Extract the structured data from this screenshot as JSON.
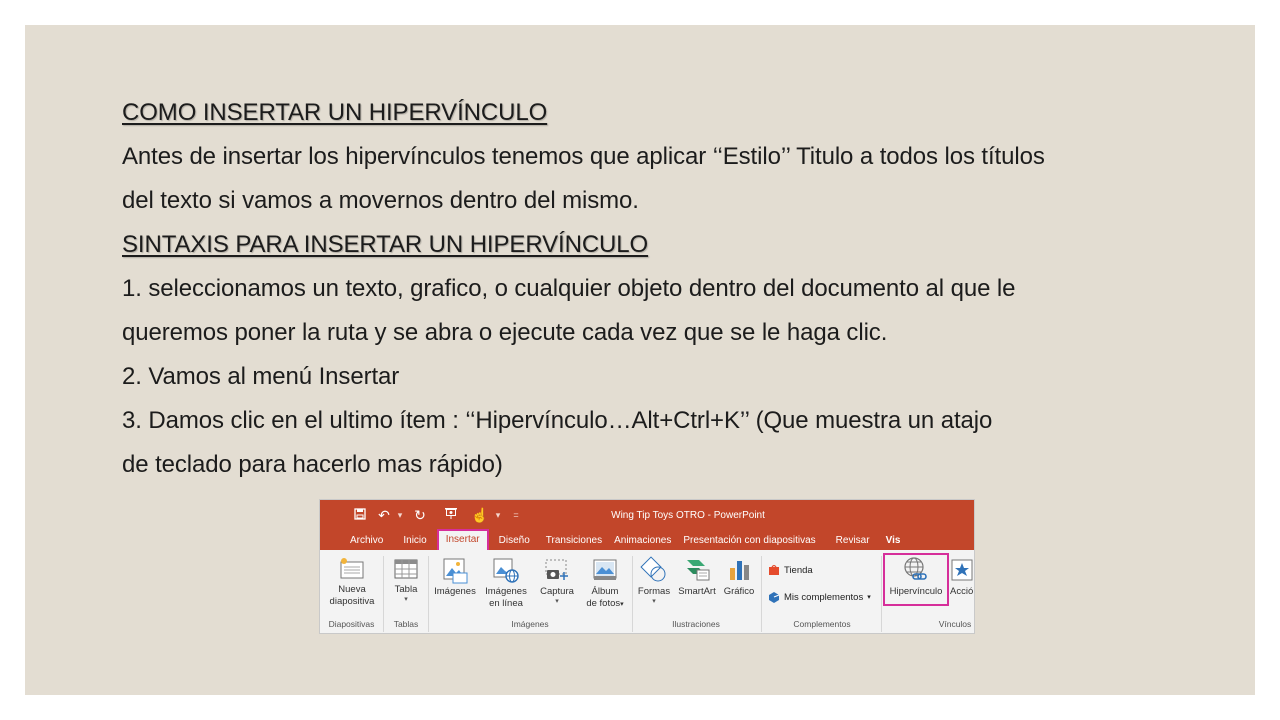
{
  "slide": {
    "heading1": "COMO INSERTAR UN HIPERVÍNCULO",
    "para1_line1": "Antes de insertar los hipervínculos tenemos que aplicar ‘‘Estilo’’ Titulo a todos los títulos",
    "para1_line2": "del texto si vamos a movernos dentro del mismo.",
    "heading2": "SINTAXIS PARA INSERTAR UN HIPERVÍNCULO",
    "step1_line1": "1. seleccionamos un texto, grafico, o cualquier objeto dentro del documento al que le",
    "step1_line2": "queremos poner la ruta y se abra o ejecute cada vez que se le haga clic.",
    "step2": "2. Vamos al menú Insertar",
    "step3_line1": "3. Damos clic en el ultimo ítem : ‘‘Hipervínculo…Alt+Ctrl+K’’ (Que muestra un atajo",
    "step3_line2": "de teclado para hacerlo mas rápido)"
  },
  "ribbon": {
    "window_title": "Wing Tip Toys OTRO - PowerPoint",
    "tabs": [
      "Archivo",
      "Inicio",
      "Insertar",
      "Diseño",
      "Transiciones",
      "Animaciones",
      "Presentación con diapositivas",
      "Revisar",
      "Vis"
    ],
    "active_tab": "Insertar",
    "buttons": {
      "nueva_line1": "Nueva",
      "nueva_line2": "diapositiva",
      "tabla": "Tabla",
      "imagenes": "Imágenes",
      "imagenes_linea_line1": "Imágenes",
      "imagenes_linea_line2": "en línea",
      "captura": "Captura",
      "album_line1": "Álbum",
      "album_line2": "de fotos",
      "formas": "Formas",
      "smartart": "SmartArt",
      "grafico": "Gráfico",
      "tienda": "Tienda",
      "mis_complementos": "Mis complementos",
      "hipervinculo": "Hipervínculo",
      "accion": "Acció"
    },
    "groups": {
      "diapositivas": "Diapositivas",
      "tablas": "Tablas",
      "imagenes": "Imágenes",
      "ilustraciones": "Ilustraciones",
      "complementos": "Complementos",
      "vinculos": "Vínculos"
    },
    "colors": {
      "titlebar": "#c2462a",
      "highlight": "#d62e9a"
    },
    "icons": [
      "save-icon",
      "undo-icon",
      "redo-icon",
      "present-icon",
      "touch-icon",
      "customize-icon"
    ]
  }
}
